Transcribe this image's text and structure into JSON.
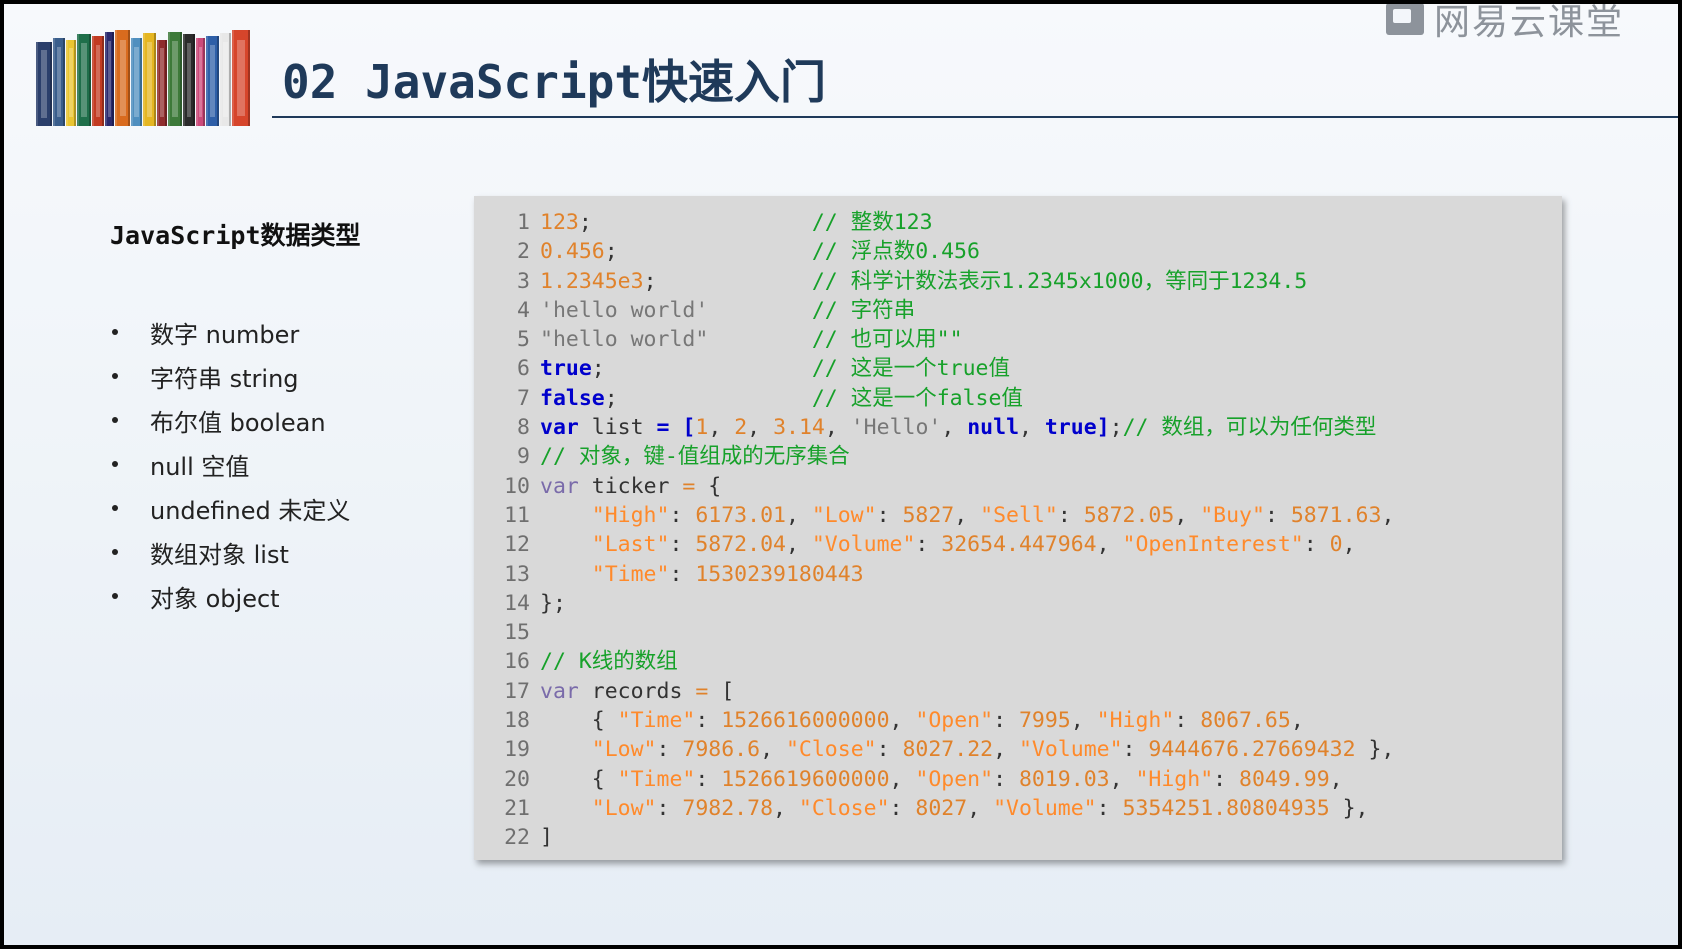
{
  "slide_title": "02 JavaScript快速入门",
  "watermark": "网易云课堂",
  "subtitle": "JavaScript数据类型",
  "bullets": [
    "数字 number",
    "字符串 string",
    "布尔值 boolean",
    "null 空值",
    "undefined 未定义",
    "数组对象 list",
    "对象 object"
  ],
  "colors": {
    "title": "#1f3a5a",
    "code_bg": "#d9d9d9",
    "keyword": "#0000cc",
    "number": "#e0822b",
    "comment": "#17a12a",
    "string_gray": "#777777",
    "var_keyword": "#7a6baa"
  },
  "book_colors": [
    "#2b3f6b",
    "#3a5e8c",
    "#e9c531",
    "#1f6f4a",
    "#c23b22",
    "#2a2a6e",
    "#d96b1e",
    "#4f8fbf",
    "#e5b622",
    "#8f2d2d",
    "#3d7a3a",
    "#2b2b2b",
    "#cc4a7a",
    "#2e5fa8",
    "#e8e8e8",
    "#d6452b"
  ],
  "code": [
    {
      "n": "1",
      "tokens": [
        [
          "num",
          "123"
        ],
        [
          "p",
          ";"
        ],
        [
          "p",
          "                 "
        ],
        [
          "cm",
          "// 整数123"
        ]
      ]
    },
    {
      "n": "2",
      "tokens": [
        [
          "num",
          "0.456"
        ],
        [
          "p",
          ";"
        ],
        [
          "p",
          "               "
        ],
        [
          "cm",
          "// 浮点数0.456"
        ]
      ]
    },
    {
      "n": "3",
      "tokens": [
        [
          "num",
          "1.2345e3"
        ],
        [
          "p",
          ";"
        ],
        [
          "p",
          "            "
        ],
        [
          "cm",
          "// 科学计数法表示1.2345x1000，等同于1234.5"
        ]
      ]
    },
    {
      "n": "4",
      "tokens": [
        [
          "strg",
          "'hello world'"
        ],
        [
          "p",
          "        "
        ],
        [
          "cm",
          "// 字符串"
        ]
      ]
    },
    {
      "n": "5",
      "tokens": [
        [
          "strg",
          "\"hello world\""
        ],
        [
          "p",
          "        "
        ],
        [
          "cm",
          "// 也可以用\"\""
        ]
      ]
    },
    {
      "n": "6",
      "tokens": [
        [
          "kw",
          "true"
        ],
        [
          "p",
          ";"
        ],
        [
          "p",
          "                "
        ],
        [
          "cm",
          "// 这是一个true值"
        ]
      ]
    },
    {
      "n": "7",
      "tokens": [
        [
          "kw",
          "false"
        ],
        [
          "p",
          ";"
        ],
        [
          "p",
          "               "
        ],
        [
          "cm",
          "// 这是一个false值"
        ]
      ]
    },
    {
      "n": "8",
      "tokens": [
        [
          "kw",
          "var"
        ],
        [
          "p",
          " list "
        ],
        [
          "kw",
          "="
        ],
        [
          "p",
          " "
        ],
        [
          "kw",
          "["
        ],
        [
          "num",
          "1"
        ],
        [
          "p",
          ", "
        ],
        [
          "num",
          "2"
        ],
        [
          "p",
          ", "
        ],
        [
          "num",
          "3.14"
        ],
        [
          "p",
          ", "
        ],
        [
          "strg",
          "'Hello'"
        ],
        [
          "p",
          ", "
        ],
        [
          "kw",
          "null"
        ],
        [
          "p",
          ", "
        ],
        [
          "kw",
          "true"
        ],
        [
          "kw",
          "]"
        ],
        [
          "p",
          ";"
        ],
        [
          "cm",
          "// 数组，可以为任何类型"
        ]
      ]
    },
    {
      "n": "9",
      "tokens": [
        [
          "cm",
          "// 对象，键-值组成的无序集合"
        ]
      ]
    },
    {
      "n": "10",
      "tokens": [
        [
          "var",
          "var"
        ],
        [
          "p",
          " ticker "
        ],
        [
          "op",
          "="
        ],
        [
          "p",
          " {"
        ]
      ]
    },
    {
      "n": "11",
      "tokens": [
        [
          "p",
          "    "
        ],
        [
          "str",
          "\"High\""
        ],
        [
          "p",
          ": "
        ],
        [
          "num",
          "6173.01"
        ],
        [
          "p",
          ", "
        ],
        [
          "str",
          "\"Low\""
        ],
        [
          "p",
          ": "
        ],
        [
          "num",
          "5827"
        ],
        [
          "p",
          ", "
        ],
        [
          "str",
          "\"Sell\""
        ],
        [
          "p",
          ": "
        ],
        [
          "num",
          "5872.05"
        ],
        [
          "p",
          ", "
        ],
        [
          "str",
          "\"Buy\""
        ],
        [
          "p",
          ": "
        ],
        [
          "num",
          "5871.63"
        ],
        [
          "p",
          ","
        ]
      ]
    },
    {
      "n": "12",
      "tokens": [
        [
          "p",
          "    "
        ],
        [
          "str",
          "\"Last\""
        ],
        [
          "p",
          ": "
        ],
        [
          "num",
          "5872.04"
        ],
        [
          "p",
          ", "
        ],
        [
          "str",
          "\"Volume\""
        ],
        [
          "p",
          ": "
        ],
        [
          "num",
          "32654.447964"
        ],
        [
          "p",
          ", "
        ],
        [
          "str",
          "\"OpenInterest\""
        ],
        [
          "p",
          ": "
        ],
        [
          "num",
          "0"
        ],
        [
          "p",
          ","
        ]
      ]
    },
    {
      "n": "13",
      "tokens": [
        [
          "p",
          "    "
        ],
        [
          "str",
          "\"Time\""
        ],
        [
          "p",
          ": "
        ],
        [
          "num",
          "1530239180443"
        ]
      ]
    },
    {
      "n": "14",
      "tokens": [
        [
          "p",
          "};"
        ]
      ]
    },
    {
      "n": "15",
      "tokens": []
    },
    {
      "n": "16",
      "tokens": [
        [
          "cm",
          "// K线的数组"
        ]
      ]
    },
    {
      "n": "17",
      "tokens": [
        [
          "var",
          "var"
        ],
        [
          "p",
          " records "
        ],
        [
          "op",
          "="
        ],
        [
          "p",
          " ["
        ]
      ]
    },
    {
      "n": "18",
      "tokens": [
        [
          "p",
          "    { "
        ],
        [
          "str",
          "\"Time\""
        ],
        [
          "p",
          ": "
        ],
        [
          "num",
          "1526616000000"
        ],
        [
          "p",
          ", "
        ],
        [
          "str",
          "\"Open\""
        ],
        [
          "p",
          ": "
        ],
        [
          "num",
          "7995"
        ],
        [
          "p",
          ", "
        ],
        [
          "str",
          "\"High\""
        ],
        [
          "p",
          ": "
        ],
        [
          "num",
          "8067.65"
        ],
        [
          "p",
          ","
        ]
      ]
    },
    {
      "n": "19",
      "tokens": [
        [
          "p",
          "    "
        ],
        [
          "str",
          "\"Low\""
        ],
        [
          "p",
          ": "
        ],
        [
          "num",
          "7986.6"
        ],
        [
          "p",
          ", "
        ],
        [
          "str",
          "\"Close\""
        ],
        [
          "p",
          ": "
        ],
        [
          "num",
          "8027.22"
        ],
        [
          "p",
          ", "
        ],
        [
          "str",
          "\"Volume\""
        ],
        [
          "p",
          ": "
        ],
        [
          "num",
          "9444676.27669432"
        ],
        [
          "p",
          " },"
        ]
      ]
    },
    {
      "n": "20",
      "tokens": [
        [
          "p",
          "    { "
        ],
        [
          "str",
          "\"Time\""
        ],
        [
          "p",
          ": "
        ],
        [
          "num",
          "1526619600000"
        ],
        [
          "p",
          ", "
        ],
        [
          "str",
          "\"Open\""
        ],
        [
          "p",
          ": "
        ],
        [
          "num",
          "8019.03"
        ],
        [
          "p",
          ", "
        ],
        [
          "str",
          "\"High\""
        ],
        [
          "p",
          ": "
        ],
        [
          "num",
          "8049.99"
        ],
        [
          "p",
          ","
        ]
      ]
    },
    {
      "n": "21",
      "tokens": [
        [
          "p",
          "    "
        ],
        [
          "str",
          "\"Low\""
        ],
        [
          "p",
          ": "
        ],
        [
          "num",
          "7982.78"
        ],
        [
          "p",
          ", "
        ],
        [
          "str",
          "\"Close\""
        ],
        [
          "p",
          ": "
        ],
        [
          "num",
          "8027"
        ],
        [
          "p",
          ", "
        ],
        [
          "str",
          "\"Volume\""
        ],
        [
          "p",
          ": "
        ],
        [
          "num",
          "5354251.80804935"
        ],
        [
          "p",
          " },"
        ]
      ]
    },
    {
      "n": "22",
      "tokens": [
        [
          "p",
          "]"
        ]
      ]
    }
  ]
}
